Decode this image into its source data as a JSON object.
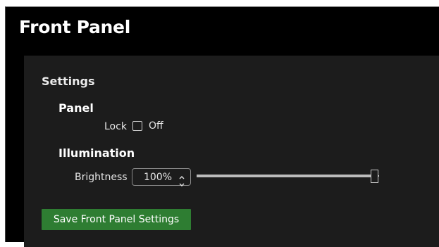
{
  "window": {
    "title": "Front Panel"
  },
  "settings": {
    "heading": "Settings",
    "panel_group": {
      "heading": "Panel",
      "lock": {
        "label": "Lock",
        "checked": false,
        "state_text": "Off"
      }
    },
    "illumination_group": {
      "heading": "Illumination",
      "brightness": {
        "label": "Brightness",
        "value_text": "100%",
        "value_percent": 100
      }
    },
    "save_button_label": "Save Front Panel Settings"
  },
  "colors": {
    "background": "#000000",
    "panel": "#1c1c1c",
    "text": "#e6e6e6",
    "save_button": "#2e7d32"
  },
  "icons": {
    "spin_up": "chevron-up-icon",
    "spin_down": "chevron-down-icon"
  }
}
